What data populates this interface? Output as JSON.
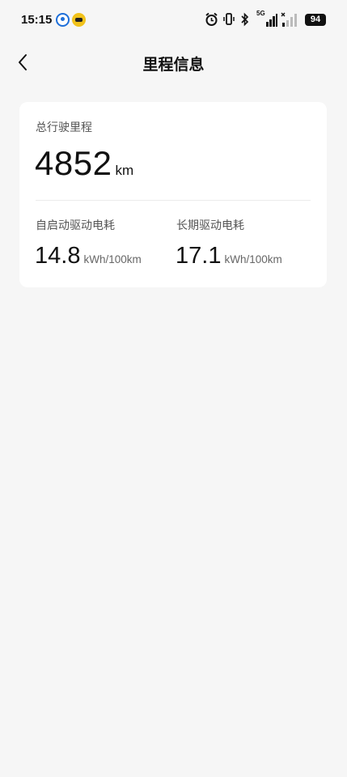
{
  "status_bar": {
    "time": "15:15",
    "network": "5G",
    "battery": "94",
    "icons": [
      "alarm-icon",
      "vibrate-icon",
      "bluetooth-icon",
      "signal-icon",
      "signal-weak-icon"
    ]
  },
  "header": {
    "title": "里程信息",
    "back_icon": "chevron-left-icon"
  },
  "card": {
    "total_label": "总行驶里程",
    "total_value": "4852",
    "total_unit": "km",
    "self_start_label": "自启动驱动电耗",
    "self_start_value": "14.8",
    "self_start_unit": "kWh/100km",
    "long_term_label": "长期驱动电耗",
    "long_term_value": "17.1",
    "long_term_unit": "kWh/100km"
  },
  "colors": {
    "background": "#f6f6f6",
    "card": "#ffffff",
    "text_primary": "#111111",
    "text_secondary": "#555555"
  }
}
